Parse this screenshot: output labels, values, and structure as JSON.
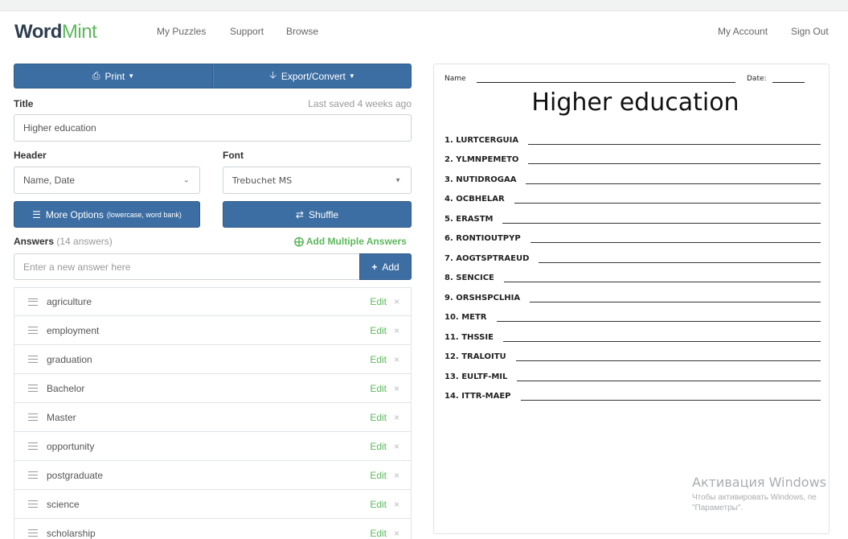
{
  "nav": {
    "logo_word": "Word",
    "logo_mint": "Mint",
    "links": [
      "My Puzzles",
      "Support",
      "Browse"
    ],
    "right_links": [
      "My Account",
      "Sign Out"
    ]
  },
  "toolbar": {
    "print_label": "Print",
    "export_label": "Export/Convert"
  },
  "form": {
    "title_label": "Title",
    "last_saved": "Last saved 4 weeks ago",
    "title_value": "Higher education",
    "header_label": "Header",
    "header_value": "Name, Date",
    "font_label": "Font",
    "font_value": "Trebuchet MS",
    "more_options_label": "More Options",
    "more_options_hint": "(lowercase, word bank)",
    "shuffle_label": "Shuffle",
    "answers_label": "Answers",
    "answers_count": "(14 answers)",
    "add_multiple_label": "Add Multiple Answers",
    "new_answer_placeholder": "Enter a new answer here",
    "add_label": "Add"
  },
  "answers": [
    "agriculture",
    "employment",
    "graduation",
    "Bachelor",
    "Master",
    "opportunity",
    "postgraduate",
    "science",
    "scholarship"
  ],
  "answer_edit_label": "Edit",
  "answer_delete_glyph": "×",
  "preview": {
    "name_label": "Name",
    "date_label": "Date:",
    "title": "Higher education",
    "items": [
      "1. LURTCERGUIA",
      "2. YLMNPEMETO",
      "3. NUTIDROGAA",
      "4. OCBHELAR",
      "5. ERASTM",
      "6. RONTIOUTPYP",
      "7. AOGTSPTRAEUD",
      "8. SENCICE",
      "9. ORSHSPCLHIA",
      "10. METR",
      "11. THSSIE",
      "12. TRALOITU",
      "13. EULTF-MIL",
      "14. ITTR-MAEP"
    ]
  },
  "watermark": {
    "line1": "Активация Windows",
    "line2": "Чтобы активировать Windows, пе",
    "line3": "\"Параметры\"."
  },
  "colors": {
    "primary_blue": "#3c6ea3",
    "accent_green": "#5cb85c",
    "logo_dark": "#2d3e4f"
  }
}
